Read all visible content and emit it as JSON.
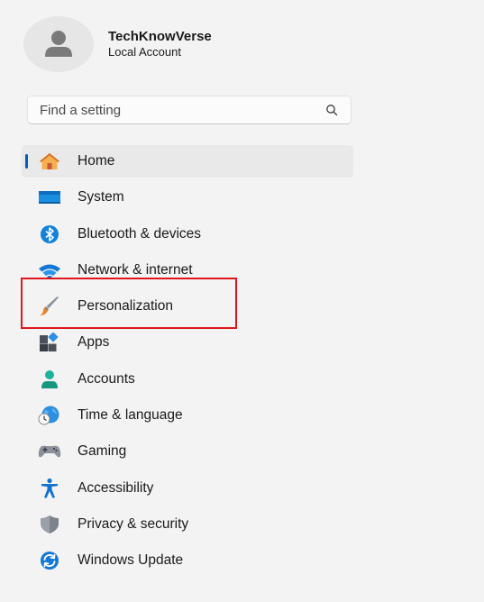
{
  "profile": {
    "name": "TechKnowVerse",
    "account_type": "Local Account",
    "avatar_icon": "person-icon"
  },
  "search": {
    "placeholder": "Find a setting",
    "icon": "search-icon"
  },
  "nav": {
    "active_index": 0,
    "highlighted_index": 3,
    "highlight_color": "#e0161c",
    "accent_color": "#005fb8",
    "items": [
      {
        "label": "Home",
        "icon": "home-icon"
      },
      {
        "label": "System",
        "icon": "monitor-icon"
      },
      {
        "label": "Bluetooth & devices",
        "icon": "bluetooth-icon"
      },
      {
        "label": "Network & internet",
        "icon": "wifi-icon"
      },
      {
        "label": "Personalization",
        "icon": "paintbrush-icon"
      },
      {
        "label": "Apps",
        "icon": "apps-icon"
      },
      {
        "label": "Accounts",
        "icon": "person-icon"
      },
      {
        "label": "Time & language",
        "icon": "globe-clock-icon"
      },
      {
        "label": "Gaming",
        "icon": "gamepad-icon"
      },
      {
        "label": "Accessibility",
        "icon": "accessibility-icon"
      },
      {
        "label": "Privacy & security",
        "icon": "shield-icon"
      },
      {
        "label": "Windows Update",
        "icon": "refresh-icon"
      }
    ]
  }
}
